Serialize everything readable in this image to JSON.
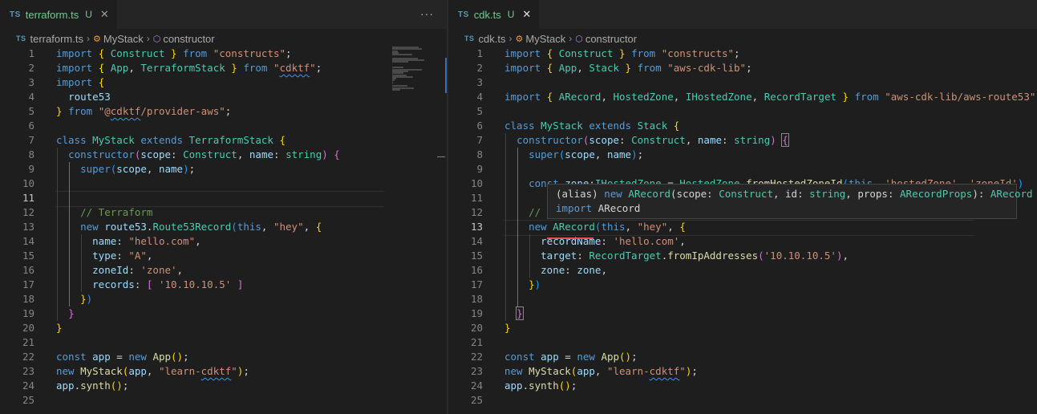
{
  "left": {
    "tab": {
      "badge": "TS",
      "name": "terraform.ts",
      "status": "U",
      "close": "✕"
    },
    "more": "···",
    "breadcrumb": {
      "badge": "TS",
      "file": "terraform.ts",
      "cls": "MyStack",
      "member": "constructor"
    },
    "current_line": 11,
    "lines": [
      {
        "n": "1",
        "t": [
          [
            "kb",
            "import "
          ],
          [
            "b1",
            "{ "
          ],
          [
            "t",
            "Construct "
          ],
          [
            "b1",
            "} "
          ],
          [
            "kb",
            "from "
          ],
          [
            "s",
            "\"constructs\""
          ],
          [
            "p",
            ";"
          ]
        ]
      },
      {
        "n": "2",
        "t": [
          [
            "kb",
            "import "
          ],
          [
            "b1",
            "{ "
          ],
          [
            "t",
            "App"
          ],
          [
            "p",
            ", "
          ],
          [
            "t",
            "TerraformStack "
          ],
          [
            "b1",
            "} "
          ],
          [
            "kb",
            "from "
          ],
          [
            "s",
            "\""
          ],
          [
            "s squig",
            "cdktf"
          ],
          [
            "s",
            "\""
          ],
          [
            "p",
            ";"
          ]
        ]
      },
      {
        "n": "3",
        "t": [
          [
            "kb",
            "import "
          ],
          [
            "b1",
            "{"
          ]
        ]
      },
      {
        "n": "4",
        "t": [
          [
            "p",
            "  "
          ],
          [
            "v",
            "route53"
          ]
        ]
      },
      {
        "n": "5",
        "t": [
          [
            "b1",
            "} "
          ],
          [
            "kb",
            "from "
          ],
          [
            "s",
            "\"@"
          ],
          [
            "s squig",
            "cdktf"
          ],
          [
            "s",
            "/provider-aws\""
          ],
          [
            "p",
            ";"
          ]
        ]
      },
      {
        "n": "6",
        "t": []
      },
      {
        "n": "7",
        "t": [
          [
            "kb",
            "class "
          ],
          [
            "t",
            "MyStack "
          ],
          [
            "kb",
            "extends "
          ],
          [
            "t",
            "TerraformStack "
          ],
          [
            "b1",
            "{"
          ]
        ]
      },
      {
        "n": "8",
        "t": [
          [
            "p",
            "  "
          ],
          [
            "kb",
            "constructor"
          ],
          [
            "b2",
            "("
          ],
          [
            "v",
            "scope"
          ],
          [
            "p",
            ": "
          ],
          [
            "t",
            "Construct"
          ],
          [
            "p",
            ", "
          ],
          [
            "v",
            "name"
          ],
          [
            "p",
            ": "
          ],
          [
            "t",
            "string"
          ],
          [
            "b2",
            ") "
          ],
          [
            "b2",
            "{"
          ]
        ]
      },
      {
        "n": "9",
        "t": [
          [
            "p",
            "    "
          ],
          [
            "kb",
            "super"
          ],
          [
            "b3",
            "("
          ],
          [
            "v",
            "scope"
          ],
          [
            "p",
            ", "
          ],
          [
            "v",
            "name"
          ],
          [
            "b3",
            ")"
          ],
          [
            "p",
            ";"
          ]
        ]
      },
      {
        "n": "10",
        "t": []
      },
      {
        "n": "11",
        "t": []
      },
      {
        "n": "12",
        "t": [
          [
            "p",
            "    "
          ],
          [
            "c",
            "// Terraform"
          ]
        ]
      },
      {
        "n": "13",
        "t": [
          [
            "p",
            "    "
          ],
          [
            "kb",
            "new "
          ],
          [
            "v",
            "route53"
          ],
          [
            "p",
            "."
          ],
          [
            "t",
            "Route53Record"
          ],
          [
            "b3",
            "("
          ],
          [
            "kb",
            "this"
          ],
          [
            "p",
            ", "
          ],
          [
            "s",
            "\"hey\""
          ],
          [
            "p",
            ", "
          ],
          [
            "b1",
            "{"
          ]
        ]
      },
      {
        "n": "14",
        "t": [
          [
            "p",
            "      "
          ],
          [
            "v",
            "name"
          ],
          [
            "p",
            ": "
          ],
          [
            "s",
            "\"hello.com\""
          ],
          [
            "p",
            ","
          ]
        ]
      },
      {
        "n": "15",
        "t": [
          [
            "p",
            "      "
          ],
          [
            "v",
            "type"
          ],
          [
            "p",
            ": "
          ],
          [
            "s",
            "\"A\""
          ],
          [
            "p",
            ","
          ]
        ]
      },
      {
        "n": "16",
        "t": [
          [
            "p",
            "      "
          ],
          [
            "v",
            "zoneId"
          ],
          [
            "p",
            ": "
          ],
          [
            "s",
            "'zone'"
          ],
          [
            "p",
            ","
          ]
        ]
      },
      {
        "n": "17",
        "t": [
          [
            "p",
            "      "
          ],
          [
            "v",
            "records"
          ],
          [
            "p",
            ": "
          ],
          [
            "b2",
            "[ "
          ],
          [
            "s",
            "'10.10.10.5' "
          ],
          [
            "b2",
            "]"
          ]
        ]
      },
      {
        "n": "18",
        "t": [
          [
            "p",
            "    "
          ],
          [
            "b1",
            "}"
          ],
          [
            "b3",
            ")"
          ]
        ]
      },
      {
        "n": "19",
        "t": [
          [
            "p",
            "  "
          ],
          [
            "b2",
            "}"
          ]
        ]
      },
      {
        "n": "20",
        "t": [
          [
            "b1",
            "}"
          ]
        ]
      },
      {
        "n": "21",
        "t": []
      },
      {
        "n": "22",
        "t": [
          [
            "kb",
            "const "
          ],
          [
            "v",
            "app "
          ],
          [
            "p",
            "= "
          ],
          [
            "kb",
            "new "
          ],
          [
            "f",
            "App"
          ],
          [
            "b1",
            "()"
          ],
          [
            "p",
            ";"
          ]
        ]
      },
      {
        "n": "23",
        "t": [
          [
            "kb",
            "new "
          ],
          [
            "f",
            "MyStack"
          ],
          [
            "b1",
            "("
          ],
          [
            "v",
            "app"
          ],
          [
            "p",
            ", "
          ],
          [
            "s",
            "\"learn-"
          ],
          [
            "s squig",
            "cdktf"
          ],
          [
            "s",
            "\""
          ],
          [
            "b1",
            ")"
          ],
          [
            "p",
            ";"
          ]
        ]
      },
      {
        "n": "24",
        "t": [
          [
            "v",
            "app"
          ],
          [
            "p",
            "."
          ],
          [
            "f",
            "synth"
          ],
          [
            "b1",
            "()"
          ],
          [
            "p",
            ";"
          ]
        ]
      },
      {
        "n": "25",
        "t": []
      }
    ]
  },
  "right": {
    "tab": {
      "badge": "TS",
      "name": "cdk.ts",
      "status": "U",
      "close": "✕"
    },
    "breadcrumb": {
      "badge": "TS",
      "file": "cdk.ts",
      "cls": "MyStack",
      "member": "constructor"
    },
    "current_line": 13,
    "lines": [
      {
        "n": "1",
        "t": [
          [
            "kb",
            "import "
          ],
          [
            "b1",
            "{ "
          ],
          [
            "t",
            "Construct "
          ],
          [
            "b1",
            "} "
          ],
          [
            "kb",
            "from "
          ],
          [
            "s",
            "\"constructs\""
          ],
          [
            "p",
            ";"
          ]
        ]
      },
      {
        "n": "2",
        "t": [
          [
            "kb",
            "import "
          ],
          [
            "b1",
            "{ "
          ],
          [
            "t",
            "App"
          ],
          [
            "p",
            ", "
          ],
          [
            "t",
            "Stack "
          ],
          [
            "b1",
            "} "
          ],
          [
            "kb",
            "from "
          ],
          [
            "s",
            "\"aws-cdk-lib\""
          ],
          [
            "p",
            ";"
          ]
        ]
      },
      {
        "n": "3",
        "t": []
      },
      {
        "n": "4",
        "t": [
          [
            "kb",
            "import "
          ],
          [
            "b1",
            "{ "
          ],
          [
            "t",
            "ARecord"
          ],
          [
            "p",
            ", "
          ],
          [
            "t",
            "HostedZone"
          ],
          [
            "p",
            ", "
          ],
          [
            "t",
            "IHostedZone"
          ],
          [
            "p",
            ", "
          ],
          [
            "t",
            "RecordTarget "
          ],
          [
            "b1",
            "} "
          ],
          [
            "kb",
            "from "
          ],
          [
            "s",
            "\"aws-cdk-lib/aws-route53\""
          ]
        ]
      },
      {
        "n": "5",
        "t": []
      },
      {
        "n": "6",
        "t": [
          [
            "kb",
            "class "
          ],
          [
            "t",
            "MyStack "
          ],
          [
            "kb",
            "extends "
          ],
          [
            "t",
            "Stack "
          ],
          [
            "b1",
            "{"
          ]
        ]
      },
      {
        "n": "7",
        "t": [
          [
            "p",
            "  "
          ],
          [
            "kb",
            "constructor"
          ],
          [
            "b2",
            "("
          ],
          [
            "v",
            "scope"
          ],
          [
            "p",
            ": "
          ],
          [
            "t",
            "Construct"
          ],
          [
            "p",
            ", "
          ],
          [
            "v",
            "name"
          ],
          [
            "p",
            ": "
          ],
          [
            "t",
            "string"
          ],
          [
            "b2",
            ") "
          ],
          [
            "b2 bracket-hl",
            "{"
          ]
        ]
      },
      {
        "n": "8",
        "t": [
          [
            "p",
            "    "
          ],
          [
            "kb",
            "super"
          ],
          [
            "b3",
            "("
          ],
          [
            "v",
            "scope"
          ],
          [
            "p",
            ", "
          ],
          [
            "v",
            "name"
          ],
          [
            "b3",
            ")"
          ],
          [
            "p",
            ";"
          ]
        ]
      },
      {
        "n": "9",
        "t": []
      },
      {
        "n": "10",
        "t": [
          [
            "p",
            "    "
          ],
          [
            "kb",
            "const "
          ],
          [
            "v",
            "zone"
          ],
          [
            "p",
            ":"
          ],
          [
            "t",
            "IHostedZone "
          ],
          [
            "p",
            "= "
          ],
          [
            "t",
            "HostedZone"
          ],
          [
            "p",
            "."
          ],
          [
            "f",
            "fromHostedZoneId"
          ],
          [
            "b3",
            "("
          ],
          [
            "kb",
            "this"
          ],
          [
            "p",
            ", "
          ],
          [
            "s",
            "'hostedZone'"
          ],
          [
            "p",
            ", "
          ],
          [
            "s",
            "'zoneId'"
          ],
          [
            "b3",
            ")"
          ]
        ]
      },
      {
        "n": "11",
        "t": []
      },
      {
        "n": "12",
        "t": [
          [
            "p",
            "    "
          ],
          [
            "c",
            "// CDK"
          ]
        ]
      },
      {
        "n": "13",
        "t": [
          [
            "p",
            "    "
          ],
          [
            "kb",
            "new "
          ],
          [
            "t",
            "ARecord"
          ],
          [
            "b3",
            "("
          ],
          [
            "kb",
            "this"
          ],
          [
            "p",
            ", "
          ],
          [
            "s",
            "\"hey\""
          ],
          [
            "p",
            ", "
          ],
          [
            "b1",
            "{"
          ]
        ]
      },
      {
        "n": "14",
        "t": [
          [
            "p",
            "      "
          ],
          [
            "v",
            "recordName"
          ],
          [
            "p",
            ": "
          ],
          [
            "s",
            "'hello.com'"
          ],
          [
            "p",
            ","
          ]
        ]
      },
      {
        "n": "15",
        "t": [
          [
            "p",
            "      "
          ],
          [
            "v",
            "target"
          ],
          [
            "p",
            ": "
          ],
          [
            "t",
            "RecordTarget"
          ],
          [
            "p",
            "."
          ],
          [
            "f",
            "fromIpAddresses"
          ],
          [
            "b2",
            "("
          ],
          [
            "s",
            "'10.10.10.5'"
          ],
          [
            "b2",
            ")"
          ],
          [
            "p",
            ","
          ]
        ]
      },
      {
        "n": "16",
        "t": [
          [
            "p",
            "      "
          ],
          [
            "v",
            "zone"
          ],
          [
            "p",
            ": "
          ],
          [
            "v",
            "zone"
          ],
          [
            "p",
            ","
          ]
        ]
      },
      {
        "n": "17",
        "t": [
          [
            "p",
            "    "
          ],
          [
            "b1",
            "}"
          ],
          [
            "b3",
            ")"
          ]
        ]
      },
      {
        "n": "18",
        "t": []
      },
      {
        "n": "19",
        "t": [
          [
            "p",
            "  "
          ],
          [
            "b2 bracket-hl",
            "}"
          ]
        ]
      },
      {
        "n": "20",
        "t": [
          [
            "b1",
            "}"
          ]
        ]
      },
      {
        "n": "21",
        "t": []
      },
      {
        "n": "22",
        "t": [
          [
            "kb",
            "const "
          ],
          [
            "v",
            "app "
          ],
          [
            "p",
            "= "
          ],
          [
            "kb",
            "new "
          ],
          [
            "f",
            "App"
          ],
          [
            "b1",
            "()"
          ],
          [
            "p",
            ";"
          ]
        ]
      },
      {
        "n": "23",
        "t": [
          [
            "kb",
            "new "
          ],
          [
            "f",
            "MyStack"
          ],
          [
            "b1",
            "("
          ],
          [
            "v",
            "app"
          ],
          [
            "p",
            ", "
          ],
          [
            "s",
            "\"learn-"
          ],
          [
            "s squig",
            "cdktf"
          ],
          [
            "s",
            "\""
          ],
          [
            "b1",
            ")"
          ],
          [
            "p",
            ";"
          ]
        ]
      },
      {
        "n": "24",
        "t": [
          [
            "v",
            "app"
          ],
          [
            "p",
            "."
          ],
          [
            "f",
            "synth"
          ],
          [
            "b1",
            "()"
          ],
          [
            "p",
            ";"
          ]
        ]
      },
      {
        "n": "25",
        "t": []
      }
    ]
  },
  "hover": {
    "line1": [
      [
        "p",
        "(alias) "
      ],
      [
        "kb",
        "new "
      ],
      [
        "t",
        "ARecord"
      ],
      [
        "p",
        "(scope: "
      ],
      [
        "t",
        "Construct"
      ],
      [
        "p",
        ", id: "
      ],
      [
        "t",
        "string"
      ],
      [
        "p",
        ", props: "
      ],
      [
        "t",
        "ARecordProps"
      ],
      [
        "p",
        "): "
      ],
      [
        "t",
        "ARecord"
      ]
    ],
    "line2": [
      [
        "kb",
        "import "
      ],
      [
        "p",
        "ARecord"
      ]
    ]
  }
}
